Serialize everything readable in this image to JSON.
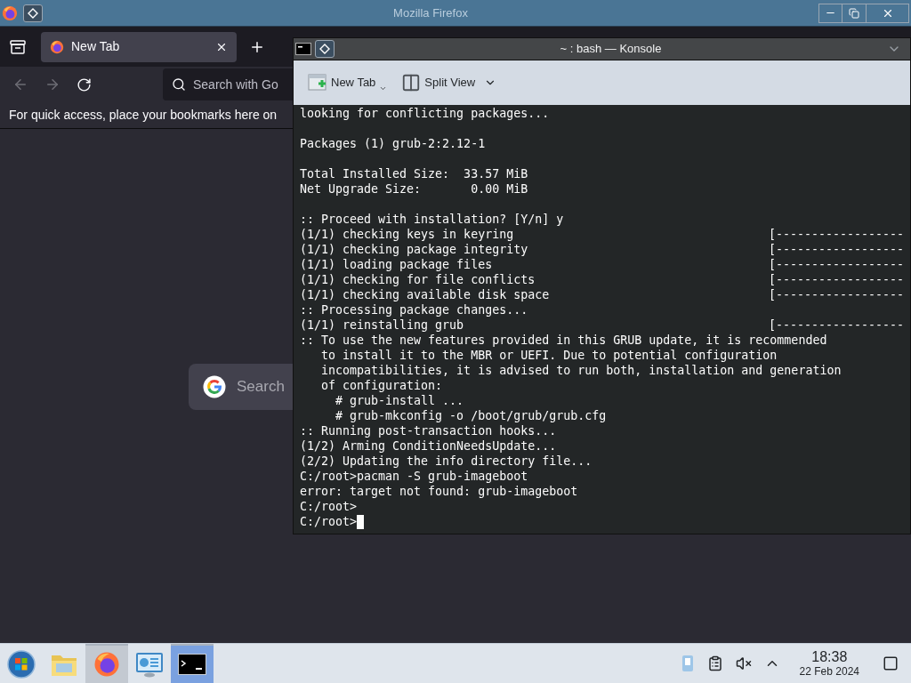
{
  "firefox": {
    "title": "Mozilla Firefox",
    "tabs": [
      {
        "label": "New Tab",
        "selected": true
      }
    ],
    "address_placeholder": "Search with Go",
    "bookmarks_hint": "For quick access, place your bookmarks here on",
    "search_placeholder": "Search"
  },
  "konsole": {
    "title": "~ : bash — Konsole",
    "toolbar": [
      {
        "label": "New Tab",
        "kind": "new-tab"
      },
      {
        "label": "Split View",
        "kind": "split-view"
      }
    ],
    "lines": [
      {
        "kind": "text",
        "text": "looking for conflicting packages..."
      },
      {
        "kind": "blank"
      },
      {
        "kind": "text",
        "text": "Packages (1) grub-2:2.12-1"
      },
      {
        "kind": "blank"
      },
      {
        "kind": "text",
        "text": "Total Installed Size:  33.57 MiB"
      },
      {
        "kind": "text",
        "text": "Net Upgrade Size:       0.00 MiB"
      },
      {
        "kind": "blank"
      },
      {
        "kind": "text",
        "text": ":: Proceed with installation? [Y/n] y"
      },
      {
        "kind": "progress",
        "text": "(1/1) checking keys in keyring",
        "bar": "[------------------"
      },
      {
        "kind": "progress",
        "text": "(1/1) checking package integrity",
        "bar": "[------------------"
      },
      {
        "kind": "progress",
        "text": "(1/1) loading package files",
        "bar": "[------------------"
      },
      {
        "kind": "progress",
        "text": "(1/1) checking for file conflicts",
        "bar": "[------------------"
      },
      {
        "kind": "progress",
        "text": "(1/1) checking available disk space",
        "bar": "[------------------"
      },
      {
        "kind": "text",
        "text": ":: Processing package changes..."
      },
      {
        "kind": "progress",
        "text": "(1/1) reinstalling grub",
        "bar": "[------------------"
      },
      {
        "kind": "text",
        "text": ":: To use the new features provided in this GRUB update, it is recommended"
      },
      {
        "kind": "text",
        "text": "   to install it to the MBR or UEFI. Due to potential configuration"
      },
      {
        "kind": "text",
        "text": "   incompatibilities, it is advised to run both, installation and generation"
      },
      {
        "kind": "text",
        "text": "   of configuration:"
      },
      {
        "kind": "text",
        "text": "     # grub-install ..."
      },
      {
        "kind": "text",
        "text": "     # grub-mkconfig -o /boot/grub/grub.cfg"
      },
      {
        "kind": "text",
        "text": ":: Running post-transaction hooks..."
      },
      {
        "kind": "text",
        "text": "(1/2) Arming ConditionNeedsUpdate..."
      },
      {
        "kind": "text",
        "text": "(2/2) Updating the info directory file..."
      },
      {
        "kind": "text",
        "text": "C:/root>pacman -S grub-imageboot"
      },
      {
        "kind": "text",
        "text": "error: target not found: grub-imageboot"
      },
      {
        "kind": "text",
        "text": "C:/root>"
      },
      {
        "kind": "prompt",
        "text": "C:/root>"
      }
    ]
  },
  "taskbar": {
    "apps": [
      {
        "kind": "start",
        "running": false,
        "selected": false
      },
      {
        "kind": "files",
        "running": false,
        "selected": false
      },
      {
        "kind": "browser",
        "running": true,
        "selected": false
      },
      {
        "kind": "settings",
        "running": false,
        "selected": false
      },
      {
        "kind": "terminal",
        "running": true,
        "selected": true
      }
    ],
    "time": "18:38",
    "date": "22 Feb 2024"
  }
}
